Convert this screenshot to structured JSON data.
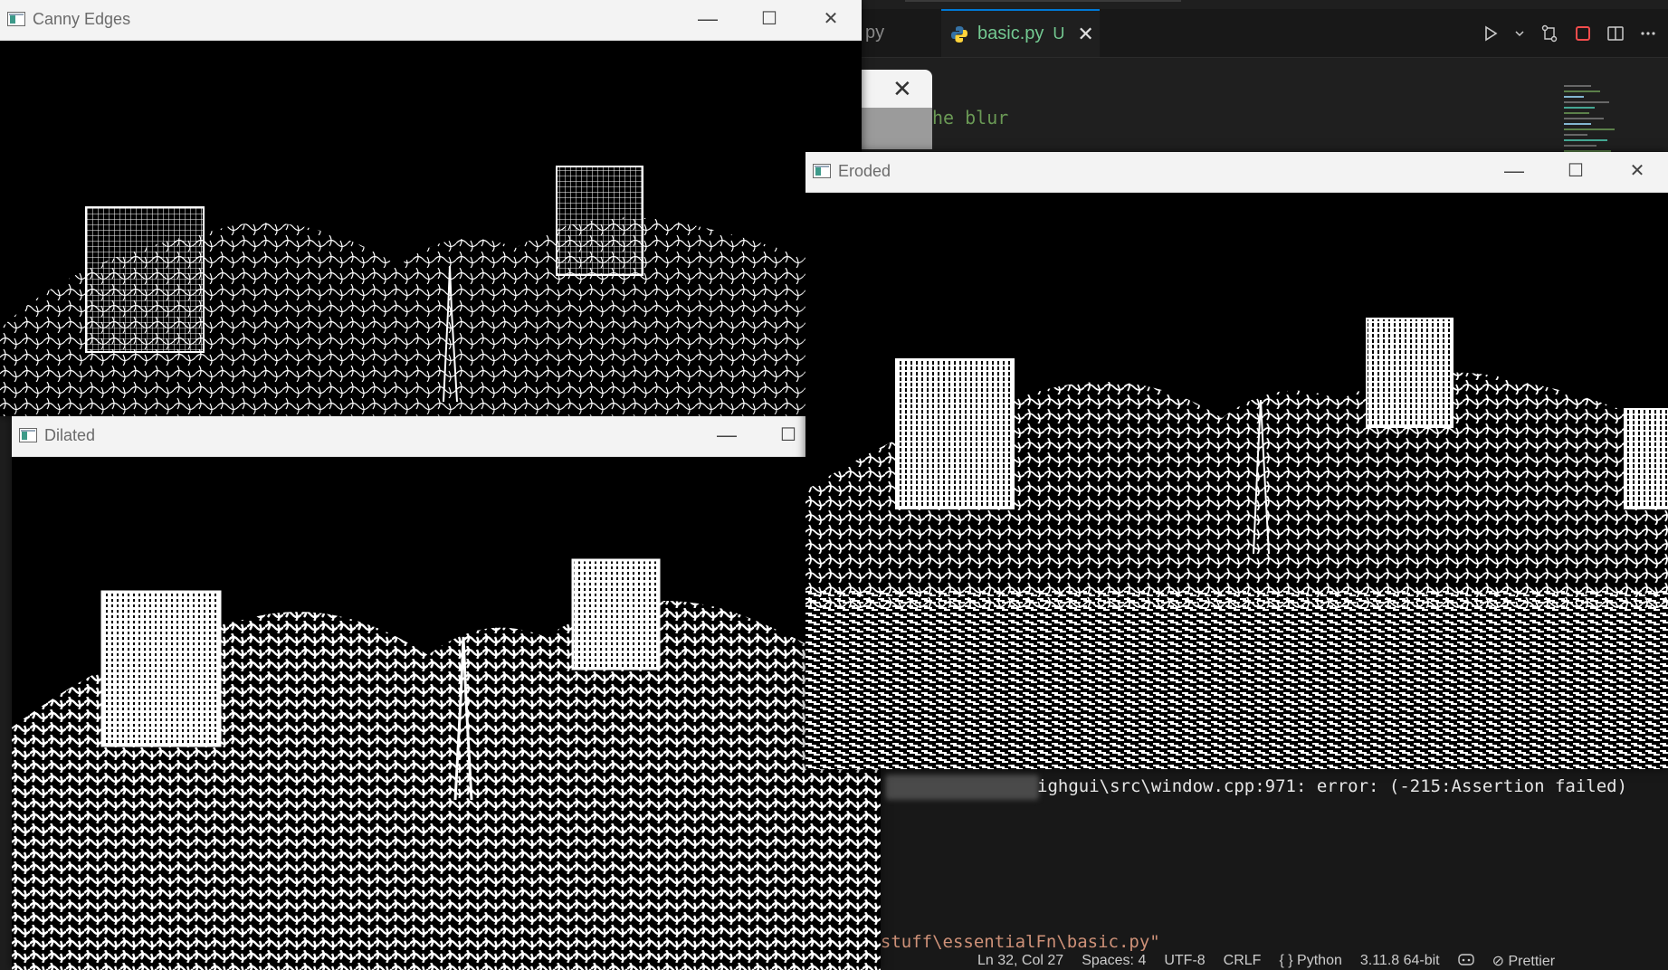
{
  "editor": {
    "tab_partial": "py",
    "tab_active_label": "basic.py",
    "tab_active_status": "U",
    "tab_close": "✕",
    "code_fragment": "he blur",
    "actions": [
      "run-icon",
      "chevron-down-icon",
      "compare-icon",
      "stop-icon",
      "split-icon",
      "more-icon"
    ]
  },
  "terminal": {
    "error_text": "ighgui\\src\\window.cpp:971: error: (-215:Assertion failed)",
    "path_text": "/-stuff\\essentialFn\\basic.py\""
  },
  "statusbar": {
    "position": "Ln 32, Col 27",
    "spaces": "Spaces: 4",
    "encoding": "UTF-8",
    "eol": "CRLF",
    "language": "Python",
    "interpreter": "3.11.8 64-bit",
    "formatter": "Prettier"
  },
  "windows": {
    "canny": {
      "title": "Canny Edges"
    },
    "dilated": {
      "title": "Dilated"
    },
    "eroded": {
      "title": "Eroded"
    }
  },
  "window_buttons": {
    "minimize": "—",
    "maximize": "☐",
    "close": "✕"
  },
  "colors": {
    "accent": "#0078d4",
    "untracked": "#73c991",
    "comment": "#6a9955"
  }
}
